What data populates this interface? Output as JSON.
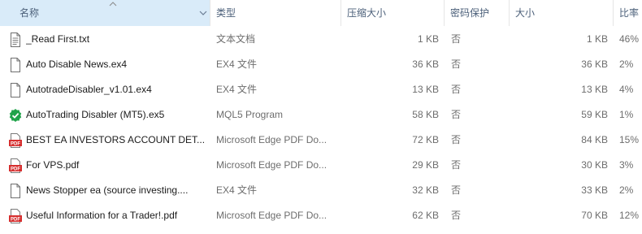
{
  "columns": {
    "name": "名称",
    "type": "类型",
    "compressed": "压缩大小",
    "encrypted": "密码保护",
    "size": "大小",
    "ratio": "比率"
  },
  "rows": [
    {
      "icon": "text-file-icon",
      "name": "_Read First.txt",
      "type": "文本文档",
      "compressed": "1 KB",
      "encrypted": "否",
      "size": "1 KB",
      "ratio": "46%"
    },
    {
      "icon": "blank-file-icon",
      "name": "Auto Disable News.ex4",
      "type": "EX4 文件",
      "compressed": "36 KB",
      "encrypted": "否",
      "size": "36 KB",
      "ratio": "2%"
    },
    {
      "icon": "blank-file-icon",
      "name": "AutotradeDisabler_v1.01.ex4",
      "type": "EX4 文件",
      "compressed": "13 KB",
      "encrypted": "否",
      "size": "13 KB",
      "ratio": "4%"
    },
    {
      "icon": "mql5-program-icon",
      "name": "AutoTrading Disabler (MT5).ex5",
      "type": "MQL5 Program",
      "compressed": "58 KB",
      "encrypted": "否",
      "size": "59 KB",
      "ratio": "1%"
    },
    {
      "icon": "pdf-file-icon",
      "name": "BEST EA INVESTORS ACCOUNT DET...",
      "type": "Microsoft Edge PDF Do...",
      "compressed": "72 KB",
      "encrypted": "否",
      "size": "84 KB",
      "ratio": "15%"
    },
    {
      "icon": "pdf-file-icon",
      "name": "For VPS.pdf",
      "type": "Microsoft Edge PDF Do...",
      "compressed": "29 KB",
      "encrypted": "否",
      "size": "30 KB",
      "ratio": "3%"
    },
    {
      "icon": "blank-file-icon",
      "name": "News Stopper ea (source investing....",
      "type": "EX4 文件",
      "compressed": "32 KB",
      "encrypted": "否",
      "size": "33 KB",
      "ratio": "2%"
    },
    {
      "icon": "pdf-file-icon",
      "name": "Useful Information for a Trader!.pdf",
      "type": "Microsoft Edge PDF Do...",
      "compressed": "62 KB",
      "encrypted": "否",
      "size": "70 KB",
      "ratio": "12%"
    }
  ],
  "colors": {
    "header_selected": "#d9ebf9",
    "header_text": "#4c607a",
    "secondary_text": "#6d6d6d",
    "pdf_red": "#d62f2f",
    "mql5_green": "#1fa34a"
  }
}
